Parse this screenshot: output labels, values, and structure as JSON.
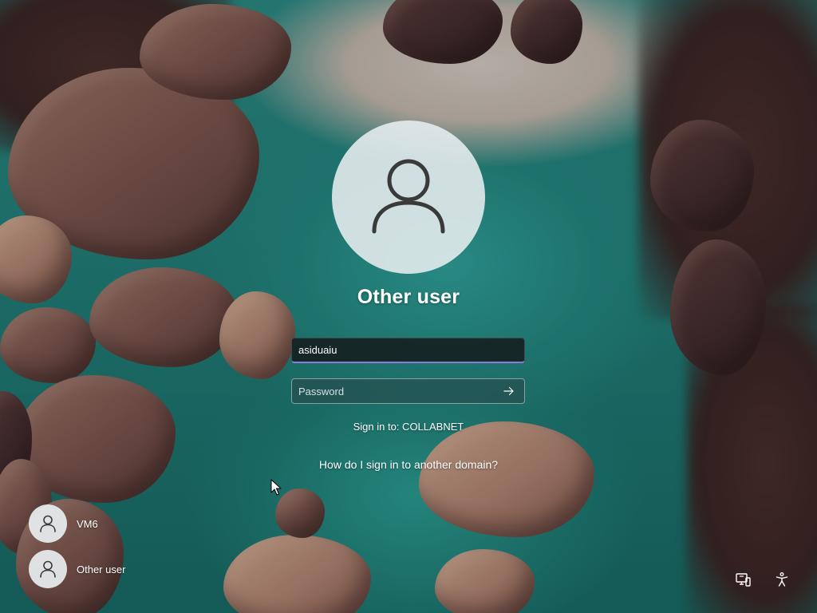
{
  "login": {
    "title": "Other user",
    "username_value": "asiduaiu",
    "password_placeholder": "Password",
    "sign_in_to": "Sign in to: COLLABNET",
    "domain_help_link": "How do I sign in to another domain?"
  },
  "user_switcher": {
    "users": [
      {
        "label": "VM6"
      },
      {
        "label": "Other user"
      }
    ]
  },
  "system_icons": {
    "network": "network-icon",
    "accessibility": "accessibility-icon"
  },
  "colors": {
    "focus_underline": "#8a7bd6",
    "avatar_background": "#e8eef0"
  }
}
